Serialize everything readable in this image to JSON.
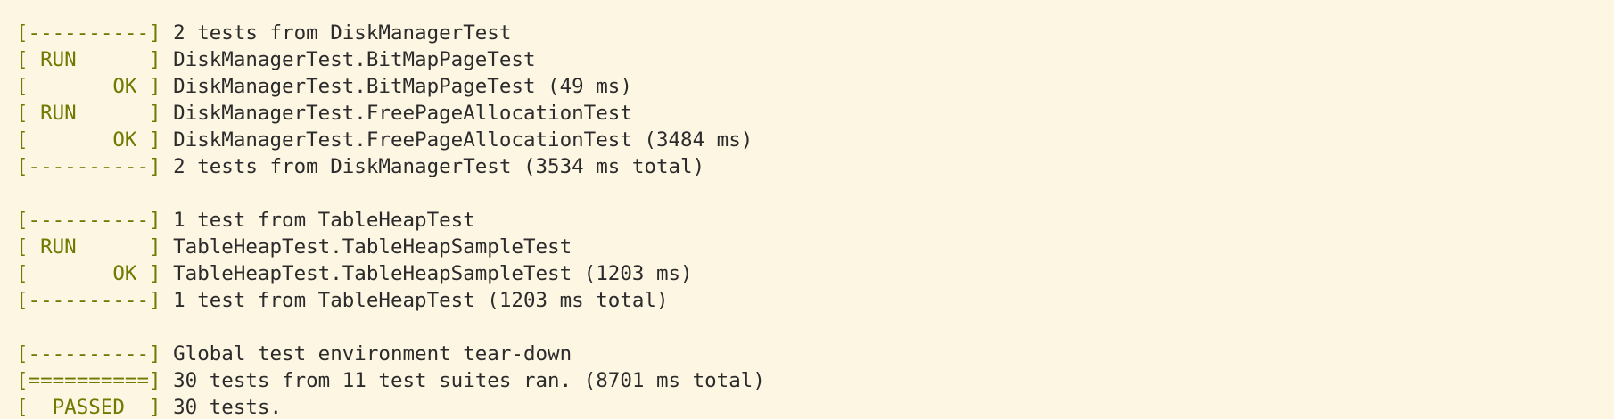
{
  "terminal": {
    "colors": {
      "background": "#fdf6e3",
      "tag": "#6f7a00",
      "text": "#2b2b2b"
    },
    "lines": [
      {
        "tag": "[----------]",
        "text": " 2 tests from DiskManagerTest"
      },
      {
        "tag": "[ RUN      ]",
        "text": " DiskManagerTest.BitMapPageTest"
      },
      {
        "tag": "[       OK ]",
        "text": " DiskManagerTest.BitMapPageTest (49 ms)"
      },
      {
        "tag": "[ RUN      ]",
        "text": " DiskManagerTest.FreePageAllocationTest"
      },
      {
        "tag": "[       OK ]",
        "text": " DiskManagerTest.FreePageAllocationTest (3484 ms)"
      },
      {
        "tag": "[----------]",
        "text": " 2 tests from DiskManagerTest (3534 ms total)"
      },
      {
        "tag": "",
        "text": ""
      },
      {
        "tag": "[----------]",
        "text": " 1 test from TableHeapTest"
      },
      {
        "tag": "[ RUN      ]",
        "text": " TableHeapTest.TableHeapSampleTest"
      },
      {
        "tag": "[       OK ]",
        "text": " TableHeapTest.TableHeapSampleTest (1203 ms)"
      },
      {
        "tag": "[----------]",
        "text": " 1 test from TableHeapTest (1203 ms total)"
      },
      {
        "tag": "",
        "text": ""
      },
      {
        "tag": "[----------]",
        "text": " Global test environment tear-down"
      },
      {
        "tag": "[==========]",
        "text": " 30 tests from 11 test suites ran. (8701 ms total)"
      },
      {
        "tag": "[  PASSED  ]",
        "text": " 30 tests."
      }
    ]
  }
}
